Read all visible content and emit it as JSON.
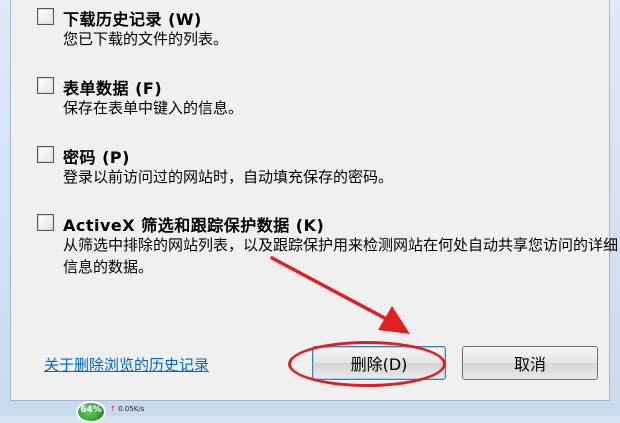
{
  "options": [
    {
      "title": "下载历史记录 (W)",
      "desc": "您已下载的文件的列表。"
    },
    {
      "title": "表单数据 (F)",
      "desc": "保存在表单中键入的信息。"
    },
    {
      "title": "密码 (P)",
      "desc": "登录以前访问过的网站时，自动填充保存的密码。"
    },
    {
      "title": "ActiveX 筛选和跟踪保护数据 (K)",
      "desc": "从筛选中排除的网站列表，以及跟踪保护用来检测网站在何处自动共享您访问的详细信息的数据。"
    }
  ],
  "footer": {
    "help_link": "关于删除浏览的历史记录",
    "delete_button": "删除(D)",
    "cancel_button": "取消"
  },
  "taskbar": {
    "net_icon_text": "64%",
    "speed": "0.05K/s"
  },
  "colors": {
    "link": "#0066cc",
    "annotation": "#e02020"
  }
}
